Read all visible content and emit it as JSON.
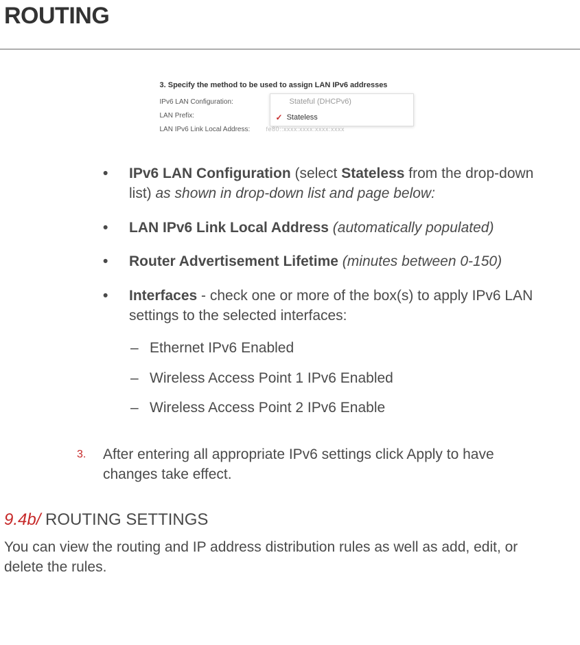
{
  "title": "ROUTING",
  "screenshot": {
    "heading": "3. Specify the method to be used to assign LAN IPv6 addresses",
    "rows": [
      {
        "label": "IPv6 LAN Configuration:"
      },
      {
        "label": "LAN Prefix:"
      },
      {
        "label": "LAN IPv6 Link Local Address:",
        "blur": "fe80::xxxx:xxxx:xxxx:xxxx"
      }
    ],
    "dropdown": {
      "options": [
        {
          "label": "Stateful (DHCPv6)",
          "selected": false
        },
        {
          "label": "Stateless",
          "selected": true
        }
      ]
    }
  },
  "bullets": [
    {
      "segments": [
        {
          "text": "IPv6 LAN Configuration",
          "bold": true
        },
        {
          "text": " (select "
        },
        {
          "text": "Stateless",
          "bold": true
        },
        {
          "text": " from the drop-down list)"
        },
        {
          "text": " as shown in drop-down list and page below:",
          "italic": true
        }
      ]
    },
    {
      "segments": [
        {
          "text": "LAN IPv6 Link Local Address",
          "bold": true
        },
        {
          "text": " (automatically populated)",
          "italic": true
        }
      ]
    },
    {
      "segments": [
        {
          "text": "Router Advertisement Lifetime",
          "bold": true
        },
        {
          "text": " (minutes between 0-150)",
          "italic": true
        }
      ]
    },
    {
      "segments": [
        {
          "text": "Interfaces",
          "bold": true
        },
        {
          "text": " - check one or more of the box(s) to apply IPv6 LAN settings to the selected interfaces:"
        }
      ],
      "subs": [
        "Ethernet IPv6 Enabled",
        "Wireless Access Point 1 IPv6 Enabled",
        "Wireless Access Point 2 IPv6 Enable"
      ]
    }
  ],
  "numbered": {
    "marker": "3.",
    "text": "After entering all appropriate IPv6 settings click Apply to have changes take effect."
  },
  "section": {
    "num": "9.4b/",
    "title": " ROUTING SETTINGS",
    "para": "You can view the routing and IP address distribution rules as well as add, edit, or delete the rules."
  }
}
